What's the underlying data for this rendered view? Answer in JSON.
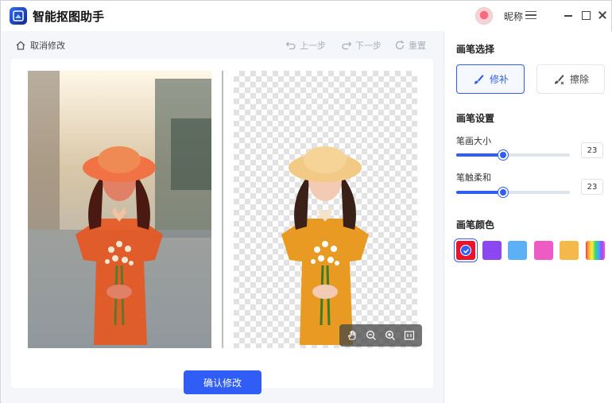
{
  "app": {
    "title": "智能抠图助手",
    "nickname": "昵称"
  },
  "toolbar": {
    "cancel_label": "取消修改",
    "undo_label": "上一步",
    "redo_label": "下一步",
    "reset_label": "重置"
  },
  "main": {
    "confirm_label": "确认修改"
  },
  "panel": {
    "brush_select_title": "画笔选择",
    "brushes": [
      {
        "label": "修补",
        "active": true
      },
      {
        "label": "擦除",
        "active": false
      }
    ],
    "brush_settings_title": "画笔设置",
    "size": {
      "label": "笔画大小",
      "value": "23",
      "level": 0.41
    },
    "softness": {
      "label": "笔触柔和",
      "value": "23",
      "level": 0.41
    },
    "color_title": "画笔颜色",
    "colors": [
      "#e8152a",
      "#8b47f2",
      "#5bb0f6",
      "#ee5bc4",
      "#f5b94b",
      "rainbow"
    ],
    "selected_color": "#e8152a"
  },
  "icons": {
    "home": "home-icon",
    "undo": "undo-icon",
    "redo": "redo-icon",
    "reset": "reset-icon",
    "hand": "hand-icon",
    "zoom_out": "zoom-out-icon",
    "zoom_in": "zoom-in-icon",
    "fit": "fit-icon",
    "brush": "brush-icon",
    "eraser": "eraser-icon"
  }
}
